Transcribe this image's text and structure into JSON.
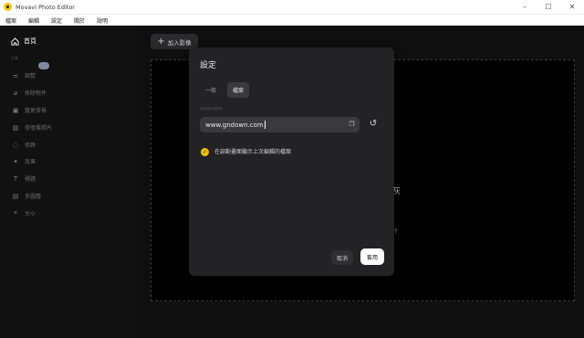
{
  "window": {
    "title": "Movavi Photo Editor",
    "controls": [
      "–",
      "☐",
      "✕"
    ]
  },
  "menu": [
    "檔案",
    "編輯",
    "設定",
    "關於",
    "說明"
  ],
  "sidebar": {
    "home_label": "首頁",
    "section_label": "工具",
    "items": [
      {
        "icon": "sliders-icon",
        "label": "調整"
      },
      {
        "icon": "eraser-icon",
        "label": "移除物件"
      },
      {
        "icon": "background-icon",
        "label": "變更背景"
      },
      {
        "icon": "photo-restore-icon",
        "label": "修復舊照片"
      },
      {
        "icon": "retouch-icon",
        "label": "修飾"
      },
      {
        "icon": "effects-icon",
        "label": "效果"
      },
      {
        "icon": "text-icon",
        "label": "標題"
      },
      {
        "icon": "layers-icon",
        "label": "多圖層"
      },
      {
        "icon": "crop-icon",
        "label": "大小"
      }
    ]
  },
  "main": {
    "add_button_label": "加入影像",
    "fragments": {
      "a": "灰",
      "b": "?"
    }
  },
  "dialog": {
    "title": "設定",
    "tabs": [
      "一般",
      "檔案"
    ],
    "active_tab": "檔案",
    "field_label": "預設儲存資料夾",
    "field_value": "www.gndown.com",
    "checkbox_label": "在啟動畫面顯示上次編輯的檔案",
    "checkbox_checked": true,
    "cancel_label": "取消",
    "apply_label": "套用"
  },
  "colors": {
    "accent": "#f2c200",
    "background": "#0f0f10",
    "dialog": "#232325"
  }
}
